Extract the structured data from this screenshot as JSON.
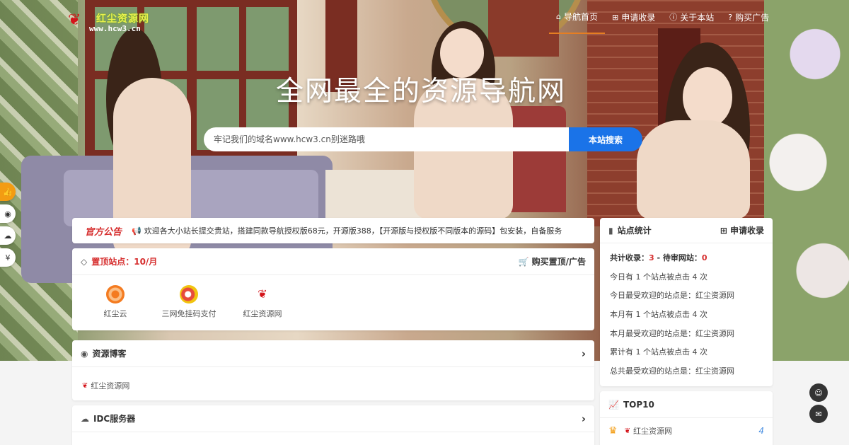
{
  "logo": {
    "brand": "红尘资源网",
    "domain": "www.hcw3.cn"
  },
  "nav": [
    {
      "icon": "home-icon",
      "label": "导航首页"
    },
    {
      "icon": "plus-square-icon",
      "label": "申请收录"
    },
    {
      "icon": "info-icon",
      "label": "关于本站"
    },
    {
      "icon": "question-icon",
      "label": "购买广告"
    }
  ],
  "hero": {
    "title": "全网最全的资源导航网"
  },
  "search": {
    "placeholder": "牢记我们的域名www.hcw3.cn别迷路哦",
    "button": "本站搜索"
  },
  "notice": {
    "title": "官方公告",
    "text": "欢迎各大小站长提交贵站，搭建同款导航授权版68元，开源版388，【开源版与授权版不同版本的源码】包安装，自备服务"
  },
  "top_sites": {
    "title": "置顶站点：10/月",
    "buy_label": "购买置顶/广告",
    "items": [
      {
        "name": "红尘云"
      },
      {
        "name": "三网免挂码支付"
      },
      {
        "name": "红尘资源网"
      }
    ]
  },
  "blog": {
    "title": "资源博客",
    "items": [
      {
        "name": "红尘资源网"
      }
    ]
  },
  "idc": {
    "title": "IDC服务器"
  },
  "stats": {
    "title": "站点统计",
    "apply_label": "申请收录",
    "total_label": "共计收录：",
    "total_value": "3",
    "sep": " - ",
    "pending_label": "待审网站：",
    "pending_value": "0",
    "lines": [
      "今日有 1 个站点被点击 4 次",
      "今日最受欢迎的站点是：红尘资源网",
      "本月有 1 个站点被点击 4 次",
      "本月最受欢迎的站点是：红尘资源网",
      "累计有 1 个站点被点击 4 次",
      "总共最受欢迎的站点是：红尘资源网"
    ]
  },
  "top10": {
    "title": "TOP10",
    "items": [
      {
        "name": "红尘资源网",
        "count": "4"
      }
    ]
  },
  "colors": {
    "accent": "#1a73e8",
    "highlight": "#d62e2e",
    "nav_active": "#e67e22"
  }
}
